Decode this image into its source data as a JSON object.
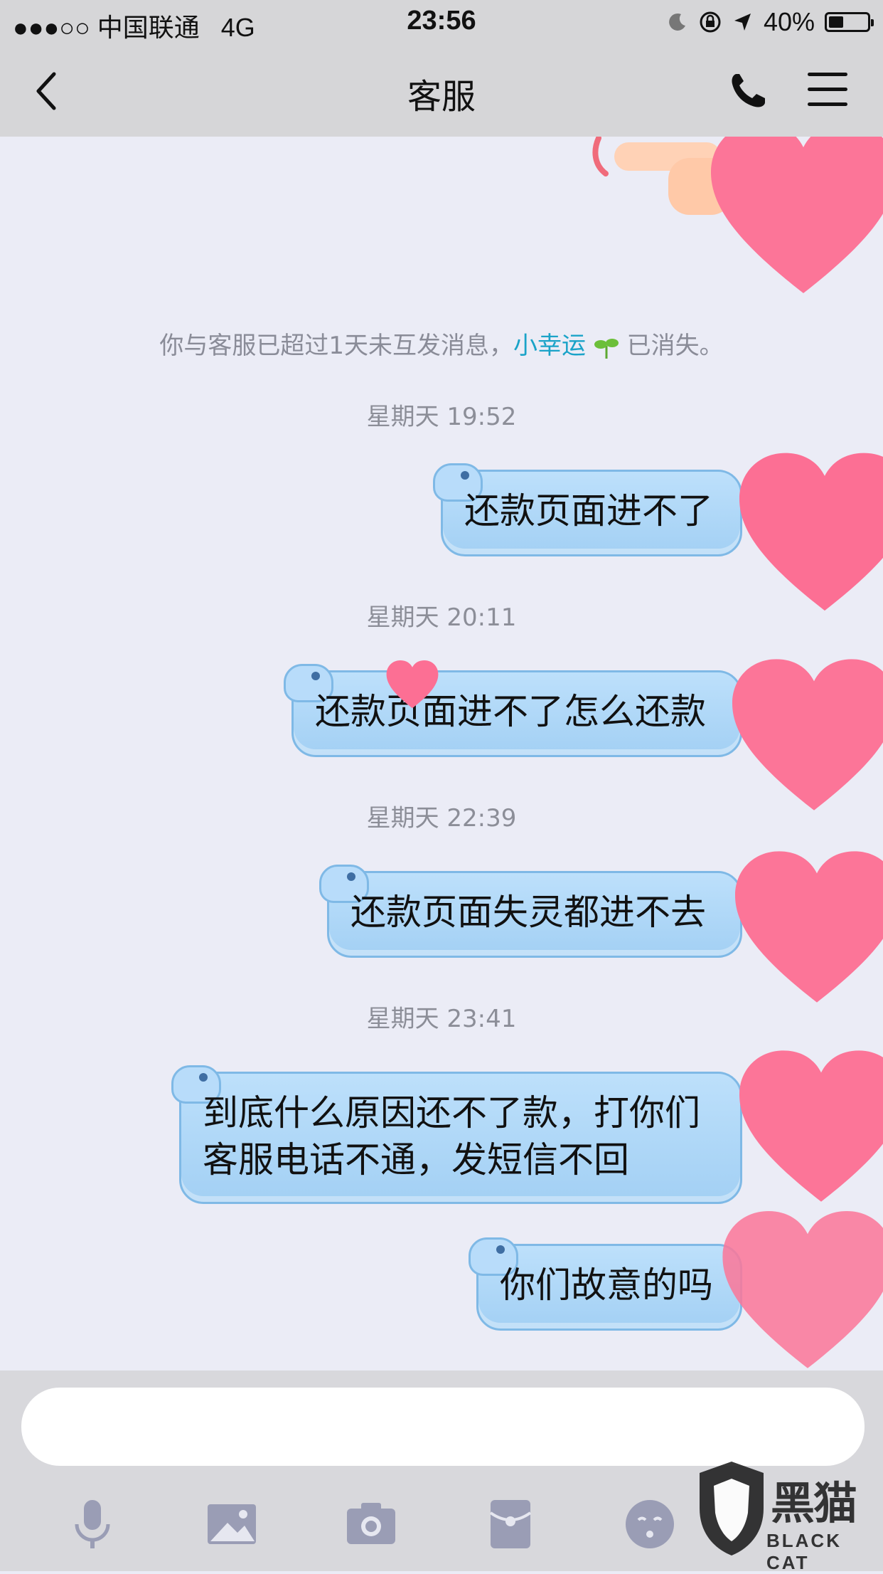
{
  "status_bar": {
    "carrier": "●●●○○ 中国联通",
    "network": "4G",
    "time": "23:56",
    "battery": "40%",
    "battery_level": 0.35
  },
  "nav": {
    "title": "客服",
    "back_icon": "chevron-left-icon",
    "phone_icon": "phone-icon",
    "menu_icon": "hamburger-menu-icon"
  },
  "chat": {
    "notice_prefix": "你与客服已超过1天未互发消息，",
    "notice_highlight": "小幸运",
    "notice_suffix": "已消失。",
    "messages": [
      {
        "time": "星期天 19:52",
        "text": "还款页面进不了"
      },
      {
        "time": "星期天 20:11",
        "text": "还款页面进不了怎么还款"
      },
      {
        "time": "星期天 22:39",
        "text": "还款页面失灵都进不去"
      },
      {
        "time": "星期天 23:41",
        "text": "到底什么原因还不了款，打你们\n客服电话不通，发短信不回"
      },
      {
        "time": "",
        "text": "你们故意的吗"
      }
    ]
  },
  "input": {
    "placeholder": ""
  },
  "toolbar": {
    "items": [
      "microphone-icon",
      "image-icon",
      "camera-icon",
      "red-packet-icon",
      "emoji-icon"
    ]
  },
  "watermark": {
    "name": "黑猫",
    "sub": "BLACK CAT"
  },
  "colors": {
    "bubble": "#a9d4f5",
    "bubble_border": "#7fb9e6",
    "heart": "#fc6f94",
    "highlight": "#1aa3c8"
  }
}
